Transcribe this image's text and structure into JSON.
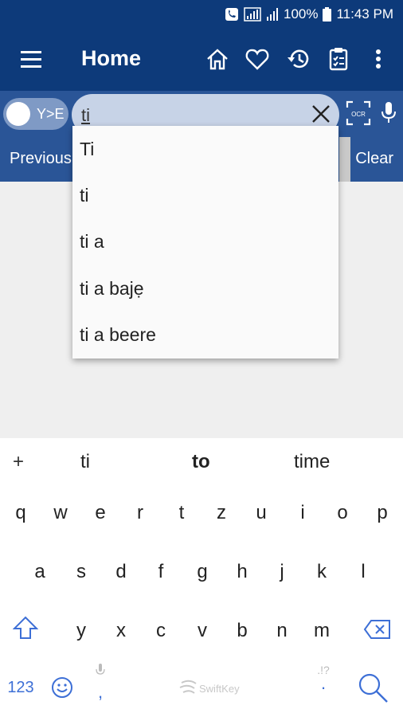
{
  "status_bar": {
    "battery": "100%",
    "time": "11:43 PM"
  },
  "app_bar": {
    "title": "Home"
  },
  "search": {
    "toggle_label": "Y>E",
    "query": "ti",
    "ocr_label": "OCR"
  },
  "nav": {
    "previous": "Previous",
    "clear": "Clear"
  },
  "suggestions": [
    "Ti",
    "ti",
    "ti a",
    "ti a bajẹ",
    "ti a beere"
  ],
  "keyboard": {
    "predictions": [
      "+",
      "ti",
      "to",
      "time"
    ],
    "row1": [
      "q",
      "w",
      "e",
      "r",
      "t",
      "z",
      "u",
      "i",
      "o",
      "p"
    ],
    "row2": [
      "a",
      "s",
      "d",
      "f",
      "g",
      "h",
      "j",
      "k",
      "l"
    ],
    "row3": [
      "y",
      "x",
      "c",
      "v",
      "b",
      "n",
      "m"
    ],
    "numbers_key": "123",
    "comma_key": ",",
    "brand": "SwiftKey",
    "punct_hint": ".!?",
    "period_key": "."
  },
  "colors": {
    "primary": "#0d3a7a",
    "secondary": "#2a5597",
    "keyboard_accent": "#3d6fd6"
  }
}
